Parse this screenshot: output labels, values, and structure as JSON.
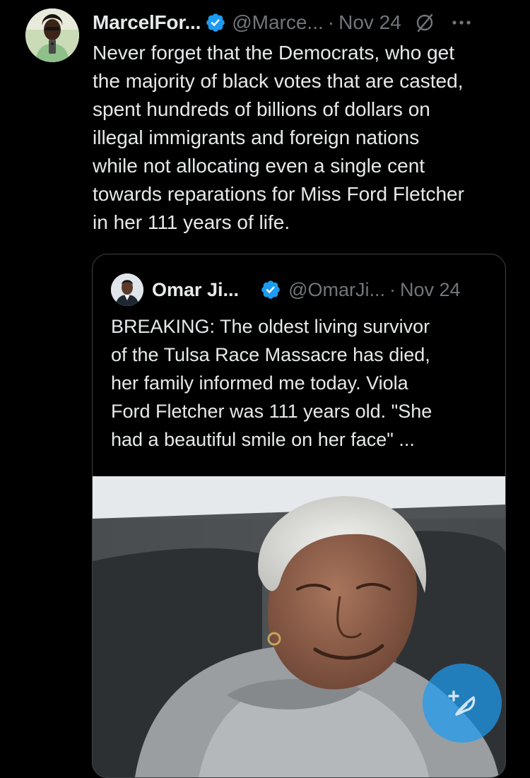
{
  "tweet": {
    "author_name": "MarcelFor...",
    "handle": "@Marce...",
    "separator": "·",
    "date": "Nov 24",
    "text": "Never forget that the Democrats, who get\nthe majority of black votes that are casted,\nspent hundreds of billions of dollars on\nillegal immigrants and foreign nations\nwhile not allocating even a single cent\ntowards reparations for Miss Ford Fletcher\nin her 111 years of life.",
    "icons": [
      "avatar",
      "verified-badge-icon",
      "grok-icon",
      "more-icon"
    ]
  },
  "quoted_tweet": {
    "author_name": "Omar Ji...",
    "handle": "@OmarJi...",
    "separator": "·",
    "date": "Nov 24",
    "text": "BREAKING: The oldest living survivor\nof the Tulsa Race Massacre has died,\nher family informed me today. Viola\nFord Fletcher was 111 years old. \"She\nhad a beautiful smile on her face\" ...",
    "icons": [
      "avatar",
      "verified-badge-icon"
    ]
  },
  "compose_button": {
    "icon": "compose-icon"
  },
  "colors": {
    "background": "#000000",
    "text_primary": "#e7e9ea",
    "text_secondary": "#71767b",
    "verified_blue": "#1d9bf0",
    "border": "#3e4144"
  }
}
